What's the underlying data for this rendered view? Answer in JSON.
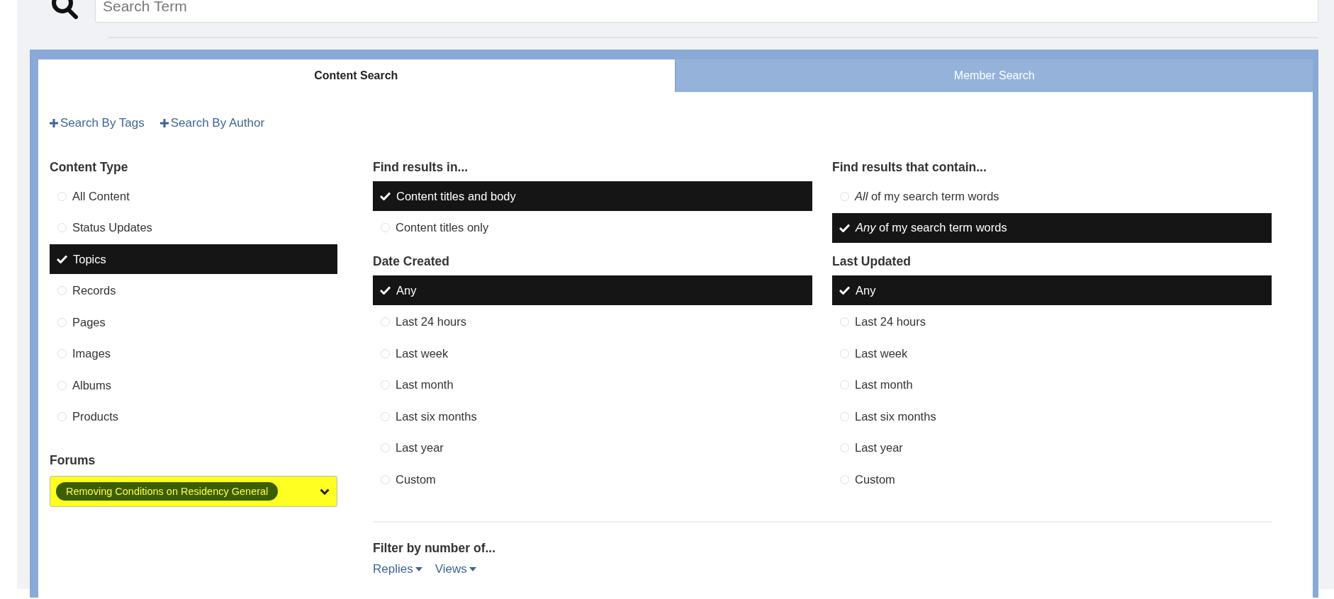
{
  "search": {
    "placeholder": "Search Term"
  },
  "tabs": [
    {
      "label": "Content Search",
      "selected": true
    },
    {
      "label": "Member Search",
      "selected": false
    }
  ],
  "links": [
    {
      "label": "Search By Tags"
    },
    {
      "label": "Search By Author"
    }
  ],
  "content_type": {
    "heading": "Content Type",
    "options": [
      {
        "label": "All Content",
        "selected": false
      },
      {
        "label": "Status Updates",
        "selected": false
      },
      {
        "label": "Topics",
        "selected": true
      },
      {
        "label": "Records",
        "selected": false
      },
      {
        "label": "Pages",
        "selected": false
      },
      {
        "label": "Images",
        "selected": false
      },
      {
        "label": "Albums",
        "selected": false
      },
      {
        "label": "Products",
        "selected": false
      }
    ]
  },
  "forums": {
    "heading": "Forums",
    "value": "Removing Conditions on Residency General",
    "highlighted": true
  },
  "find_results_in": {
    "heading": "Find results in...",
    "options": [
      {
        "label": "Content titles and body",
        "selected": true
      },
      {
        "label": "Content titles only",
        "selected": false
      }
    ]
  },
  "find_results_contain": {
    "heading": "Find results that contain...",
    "options": [
      {
        "label": "*All* of my search term words",
        "selected": false
      },
      {
        "label": "*Any* of my search term words",
        "selected": true
      }
    ]
  },
  "date_created": {
    "heading": "Date Created",
    "options": [
      {
        "label": "Any",
        "selected": true
      },
      {
        "label": "Last 24 hours",
        "selected": false
      },
      {
        "label": "Last week",
        "selected": false
      },
      {
        "label": "Last month",
        "selected": false
      },
      {
        "label": "Last six months",
        "selected": false
      },
      {
        "label": "Last year",
        "selected": false
      },
      {
        "label": "Custom",
        "selected": false
      }
    ]
  },
  "last_updated": {
    "heading": "Last Updated",
    "options": [
      {
        "label": "Any",
        "selected": true
      },
      {
        "label": "Last 24 hours",
        "selected": false
      },
      {
        "label": "Last week",
        "selected": false
      },
      {
        "label": "Last month",
        "selected": false
      },
      {
        "label": "Last six months",
        "selected": false
      },
      {
        "label": "Last year",
        "selected": false
      },
      {
        "label": "Custom",
        "selected": false
      }
    ]
  },
  "filter": {
    "heading": "Filter by number of...",
    "dropdowns": [
      {
        "label": "Replies"
      },
      {
        "label": "Views"
      }
    ]
  }
}
